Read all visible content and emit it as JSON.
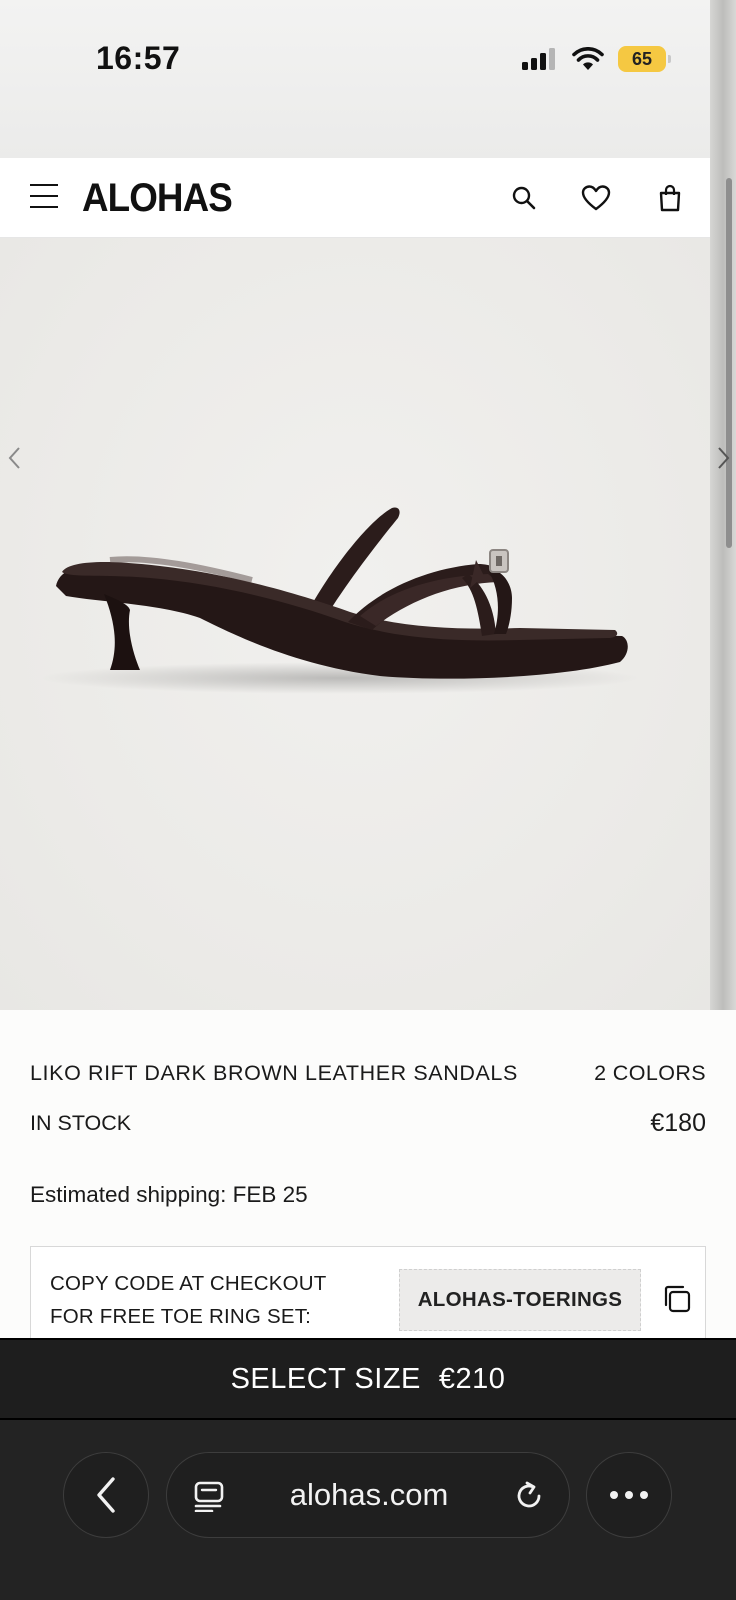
{
  "status_bar": {
    "time": "16:57",
    "battery": "65"
  },
  "header": {
    "logo": "ALOHAS"
  },
  "product": {
    "title": "LIKO RIFT DARK BROWN LEATHER SANDALS",
    "colors": "2 COLORS",
    "stock": "IN STOCK",
    "price": "€180",
    "shipping": "Estimated shipping: FEB 25"
  },
  "promo": {
    "line1": "COPY CODE AT CHECKOUT",
    "line2": "FOR FREE TOE RING SET:",
    "code": "ALOHAS-TOERINGS"
  },
  "cta": {
    "label": "SELECT SIZE",
    "price": "€210"
  },
  "browser": {
    "url": "alohas.com"
  },
  "colors": {
    "cta_bg": "#1e1e1e",
    "browser_bg": "#232323",
    "battery": "#f5c842",
    "sandal": "#2b1c1b"
  }
}
